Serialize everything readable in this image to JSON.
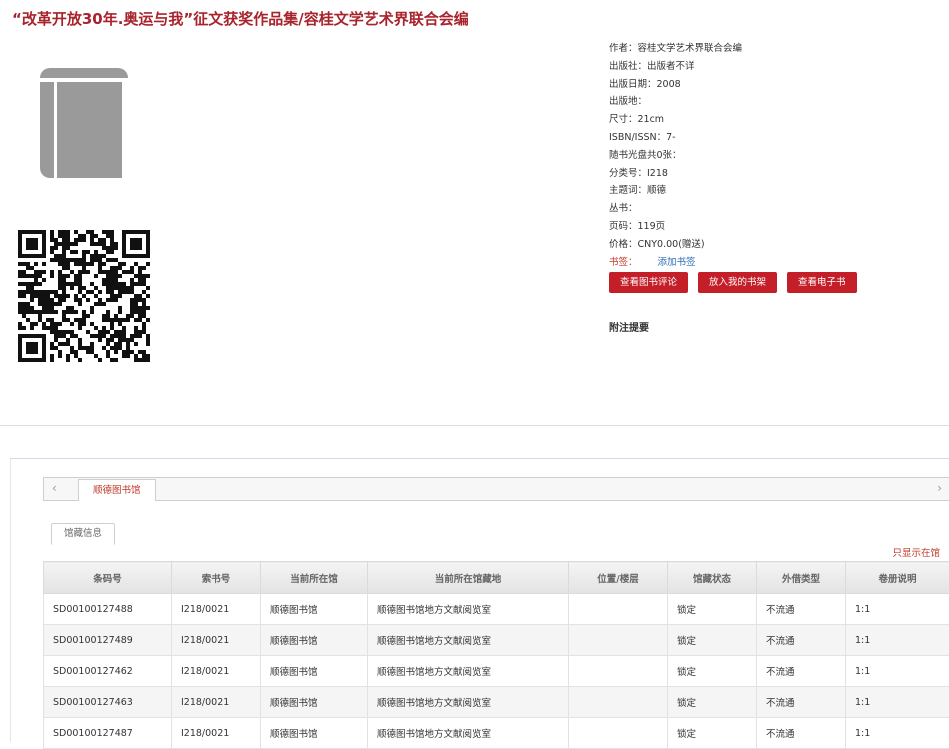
{
  "book": {
    "title": "“改革开放30年.奥运与我”征文获奖作品集/容桂文学艺术界联合会编"
  },
  "meta": {
    "author": "作者：容桂文学艺术界联合会编",
    "publisher": "出版社：出版者不详",
    "pubdate": "出版日期：2008",
    "place": "出版地：",
    "size": "尺寸：21cm",
    "isbn": "ISBN/ISSN：7-",
    "disc": "随书光盘共0张：",
    "classno": "分类号：I218",
    "subject": "主题词：顺德",
    "series": "丛书：",
    "pages": "页码：119页",
    "price": "价格：CNY0.00(赠送)",
    "bookmark_label": "书签：",
    "bookmark_add": "添加书签"
  },
  "buttons": {
    "review": "查看图书评论",
    "shelf": "放入我的书架",
    "ebook": "查看电子书"
  },
  "notes_label": "附注提要",
  "library_tab": "顺德图书馆",
  "subtab": "馆藏信息",
  "show_only": "只显示在馆",
  "table": {
    "headers": [
      "条码号",
      "索书号",
      "当前所在馆",
      "当前所在馆藏地",
      "位置/楼层",
      "馆藏状态",
      "外借类型",
      "卷册说明"
    ],
    "rows": [
      [
        "SD00100127488",
        "I218/0021",
        "顺德图书馆",
        "顺德图书馆地方文献阅览室",
        "",
        "锁定",
        "不流通",
        "1:1"
      ],
      [
        "SD00100127489",
        "I218/0021",
        "顺德图书馆",
        "顺德图书馆地方文献阅览室",
        "",
        "锁定",
        "不流通",
        "1:1"
      ],
      [
        "SD00100127462",
        "I218/0021",
        "顺德图书馆",
        "顺德图书馆地方文献阅览室",
        "",
        "锁定",
        "不流通",
        "1:1"
      ],
      [
        "SD00100127463",
        "I218/0021",
        "顺德图书馆",
        "顺德图书馆地方文献阅览室",
        "",
        "锁定",
        "不流通",
        "1:1"
      ],
      [
        "SD00100127487",
        "I218/0021",
        "顺德图书馆",
        "顺德图书馆地方文献阅览室",
        "",
        "锁定",
        "不流通",
        "1:1"
      ]
    ]
  },
  "icons": {
    "cover": "book-cover-icon",
    "qr": "qr-code",
    "prev": "chevron-left-icon",
    "next": "chevron-right-icon"
  }
}
